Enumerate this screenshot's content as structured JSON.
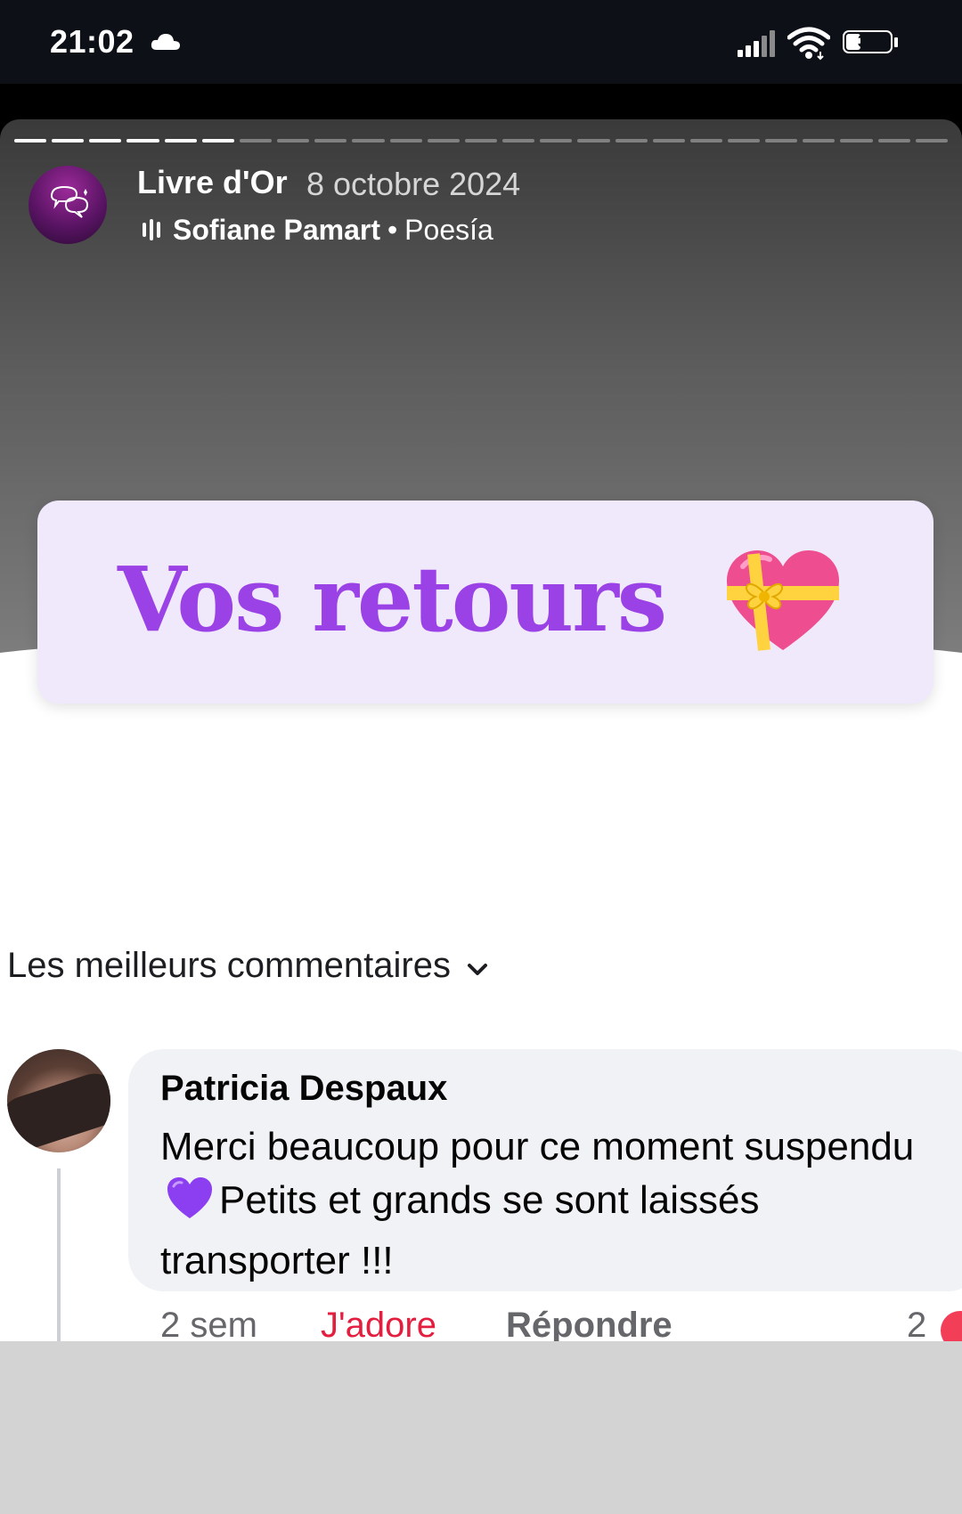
{
  "status_bar": {
    "time": "21:02",
    "battery": "33",
    "battery_level": 0.33,
    "icons": [
      "cloud-icon",
      "signal-icon",
      "wifi-icon",
      "battery-icon"
    ]
  },
  "story": {
    "progress": {
      "total": 25,
      "current": 6
    },
    "account_name": "Livre d'Or",
    "date": "8 octobre 2024",
    "music": {
      "artist": "Sofiane Pamart",
      "separator": "•",
      "track": "Poesía"
    },
    "banner_text": "Vos retours",
    "banner_emoji": "gift-heart-icon",
    "accent_color": "#9a42e6"
  },
  "comments": {
    "sort_label": "Les meilleurs commentaires",
    "items": [
      {
        "author": "Patricia Despaux",
        "text_part1": "Merci beaucoup pour ce moment suspendu",
        "emoji": "purple-heart-icon",
        "text_part2": "Petits et grands se sont laissés transporter !!!",
        "time": "2 sem",
        "love_label": "J'adore",
        "reply_label": "Répondre",
        "reaction_count": "2"
      }
    ]
  }
}
